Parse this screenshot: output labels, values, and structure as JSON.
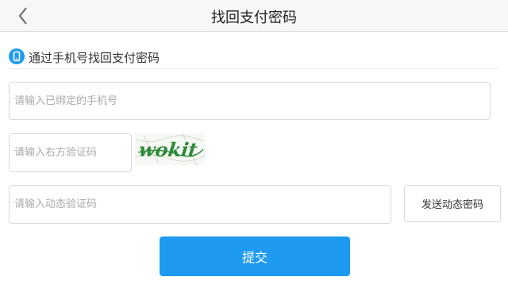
{
  "header": {
    "title": "找回支付密码",
    "back_icon": "chevron-left-icon"
  },
  "section": {
    "icon": "phone-icon",
    "icon_color": "#1e9bf0",
    "text": "通过手机号找回支付密码"
  },
  "form": {
    "phone_placeholder": "请输入已绑定的手机号",
    "captcha_placeholder": "请输入右方验证码",
    "captcha_image_text": "wokit",
    "sms_placeholder": "请输入动态验证码",
    "send_button_label": "发送动态密码",
    "submit_button_label": "提交"
  },
  "colors": {
    "accent": "#1e9bf0",
    "captcha_green": "#2f8a3a"
  }
}
